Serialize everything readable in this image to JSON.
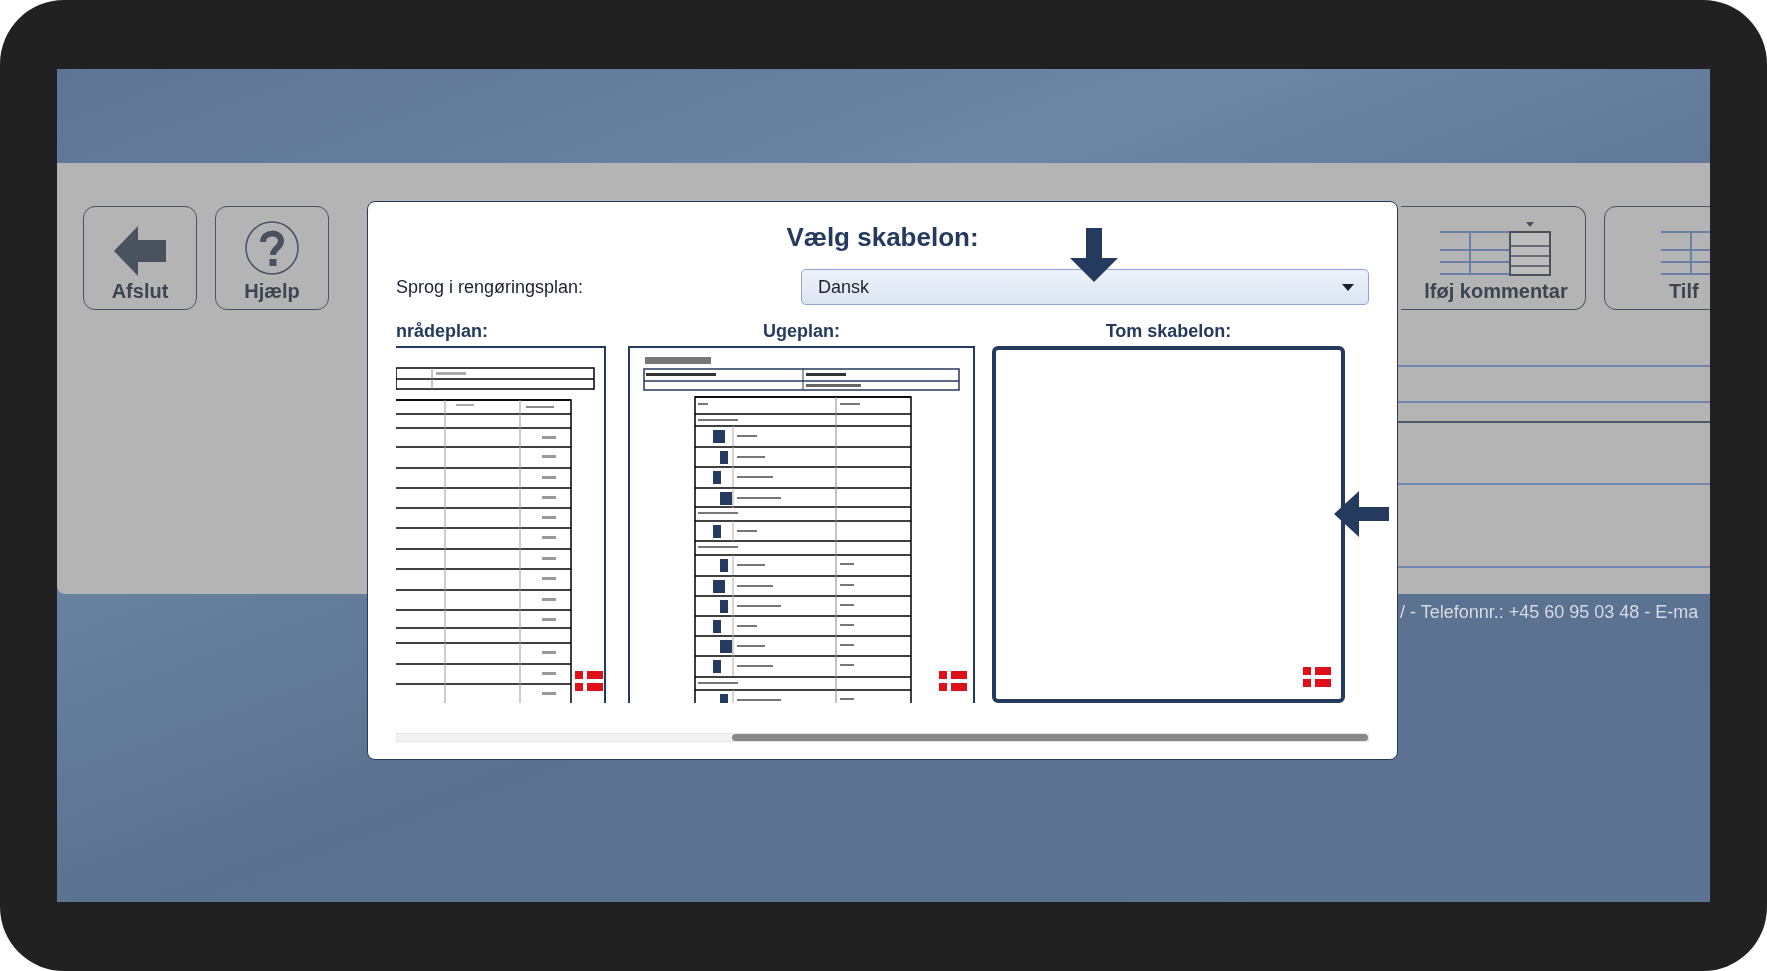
{
  "toolbar": {
    "buttons": [
      {
        "label": "Afslut",
        "kind": "exit"
      },
      {
        "label": "Hjælp",
        "kind": "help"
      },
      {
        "label": "lføj kommentar",
        "kind": "comment"
      },
      {
        "label": "Tilf",
        "kind": "table"
      }
    ]
  },
  "footer": {
    "text": "/ - Telefonnr.: +45 60 95 03 48 - E-ma"
  },
  "dialog": {
    "title": "Vælg skabelon:",
    "language_label": "Sprog i rengøringsplan:",
    "language": {
      "value": "Dansk"
    },
    "templates": [
      {
        "title": "nrådeplan:",
        "kind": "area",
        "selected": false
      },
      {
        "title": "Ugeplan:",
        "kind": "week",
        "selected": false
      },
      {
        "title": "Tom skabelon:",
        "kind": "blank",
        "selected": true
      }
    ]
  }
}
